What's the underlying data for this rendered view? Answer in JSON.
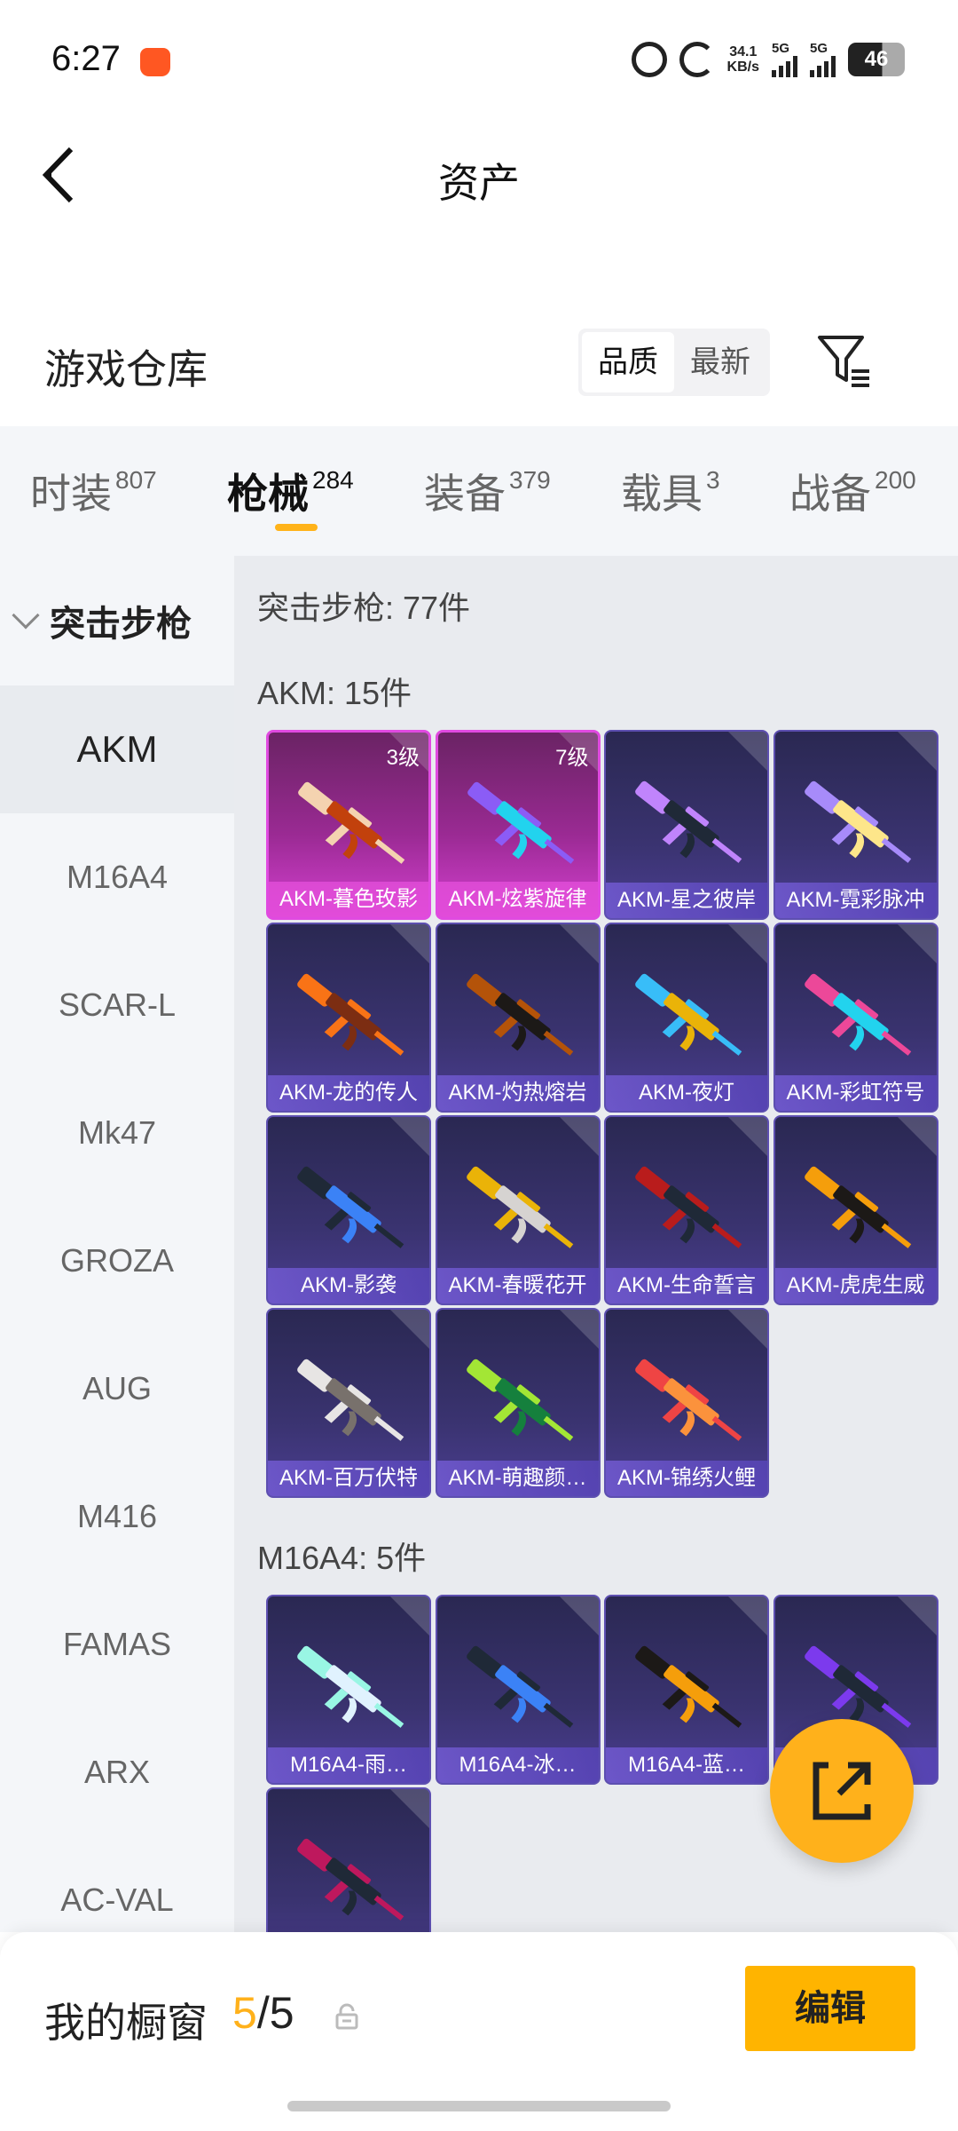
{
  "status_bar": {
    "time": "6:27",
    "net_speed_value": "34.1",
    "net_speed_unit": "KB/s",
    "sim1": "5G",
    "sim2": "5G",
    "battery": "46"
  },
  "header": {
    "title": "资产"
  },
  "section": {
    "title": "游戏仓库",
    "sort_options": [
      "品质",
      "最新"
    ],
    "sort_active": "品质"
  },
  "tabs": [
    {
      "label": "时装",
      "count": "807"
    },
    {
      "label": "枪械",
      "count": "284",
      "active": true
    },
    {
      "label": "装备",
      "count": "379"
    },
    {
      "label": "载具",
      "count": "3"
    },
    {
      "label": "战备",
      "count": "200"
    }
  ],
  "sidebar": {
    "group": "突击步枪",
    "items": [
      "AKM",
      "M16A4",
      "SCAR-L",
      "Mk47",
      "GROZA",
      "AUG",
      "M416",
      "FAMAS",
      "ARX",
      "AC-VAL"
    ],
    "active": "AKM"
  },
  "content": {
    "category_count": "突击步枪: 77件",
    "groups": [
      {
        "label": "AKM: 15件",
        "items": [
          {
            "name": "AKM-暮色玫影",
            "level": "3级",
            "rarity": "purple",
            "colors": [
              "#f4d3b0",
              "#c2410c"
            ]
          },
          {
            "name": "AKM-炫紫旋律",
            "level": "7级",
            "rarity": "purple",
            "colors": [
              "#8b5cf6",
              "#22d3ee"
            ]
          },
          {
            "name": "AKM-星之彼岸",
            "rarity": "blue",
            "colors": [
              "#c084fc",
              "#1f2937"
            ]
          },
          {
            "name": "AKM-霓彩脉冲",
            "rarity": "blue",
            "colors": [
              "#a78bfa",
              "#fde68a"
            ]
          },
          {
            "name": "AKM-龙的传人",
            "rarity": "blue",
            "colors": [
              "#f97316",
              "#7c2d12"
            ]
          },
          {
            "name": "AKM-灼热熔岩",
            "rarity": "blue",
            "colors": [
              "#b45309",
              "#1c1917"
            ]
          },
          {
            "name": "AKM-夜灯",
            "rarity": "blue",
            "colors": [
              "#38bdf8",
              "#eab308"
            ]
          },
          {
            "name": "AKM-彩虹符号",
            "rarity": "blue",
            "colors": [
              "#ec4899",
              "#22d3ee"
            ]
          },
          {
            "name": "AKM-影袭",
            "rarity": "blue",
            "colors": [
              "#1f2937",
              "#3b82f6"
            ]
          },
          {
            "name": "AKM-春暖花开",
            "rarity": "blue",
            "colors": [
              "#eab308",
              "#d6d3d1"
            ]
          },
          {
            "name": "AKM-生命誓言",
            "rarity": "blue",
            "colors": [
              "#b91c1c",
              "#1f2937"
            ]
          },
          {
            "name": "AKM-虎虎生威",
            "rarity": "blue",
            "colors": [
              "#f59e0b",
              "#1c1917"
            ]
          },
          {
            "name": "AKM-百万伏特",
            "rarity": "blue",
            "colors": [
              "#e7e5e4",
              "#78716c"
            ]
          },
          {
            "name": "AKM-萌趣颜…",
            "rarity": "blue",
            "colors": [
              "#a3e635",
              "#15803d"
            ]
          },
          {
            "name": "AKM-锦绣火鲤",
            "rarity": "blue",
            "colors": [
              "#ef4444",
              "#fb923c"
            ]
          }
        ]
      },
      {
        "label": "M16A4: 5件",
        "items": [
          {
            "name": "M16A4-雨…",
            "rarity": "blue",
            "colors": [
              "#99f6e4",
              "#e0f2fe"
            ]
          },
          {
            "name": "M16A4-冰…",
            "rarity": "blue",
            "colors": [
              "#1f2937",
              "#3b82f6"
            ]
          },
          {
            "name": "M16A4-蓝…",
            "rarity": "blue",
            "colors": [
              "#1c1917",
              "#f59e0b"
            ]
          },
          {
            "name": "",
            "rarity": "blue",
            "colors": [
              "#7c3aed",
              "#1f2937"
            ]
          },
          {
            "name": "",
            "rarity": "blue",
            "colors": [
              "#be185d",
              "#1f2937"
            ]
          }
        ]
      }
    ]
  },
  "bottom": {
    "showcase_label": "我的橱窗",
    "showcase_current": "5",
    "showcase_total": "/5",
    "edit_label": "编辑"
  }
}
